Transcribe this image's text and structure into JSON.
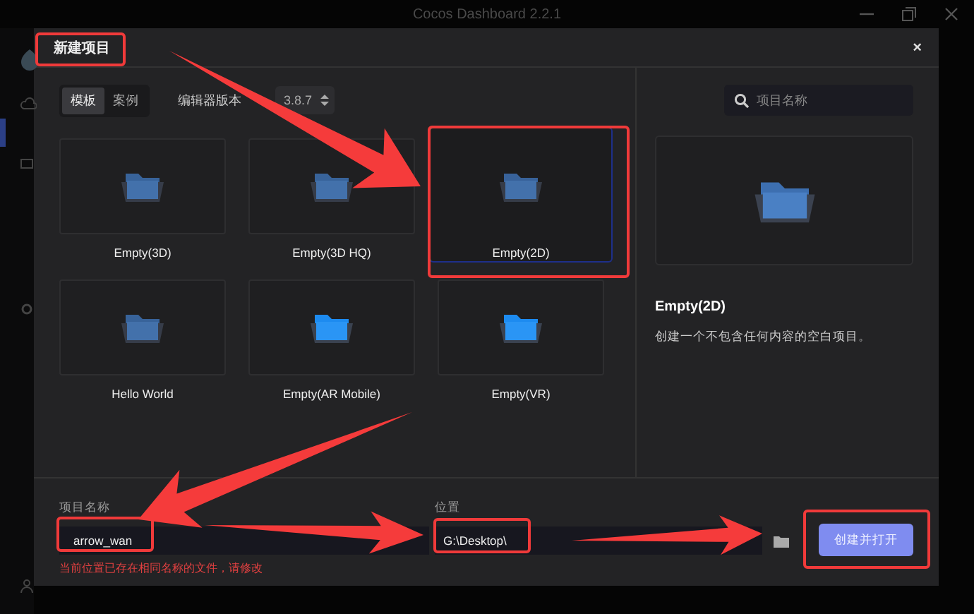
{
  "app_window": {
    "title": "Cocos Dashboard 2.2.1"
  },
  "dialog": {
    "title": "新建项目",
    "close": "×",
    "tabs": [
      {
        "label": "模板",
        "selected": true
      },
      {
        "label": "案例",
        "selected": false
      }
    ],
    "editor_version": {
      "label": "编辑器版本",
      "value": "3.8.7"
    },
    "search": {
      "placeholder": "项目名称"
    },
    "templates": [
      {
        "name": "Empty(3D)",
        "selected": false,
        "bright": false
      },
      {
        "name": "Empty(3D HQ)",
        "selected": false,
        "bright": false
      },
      {
        "name": "Empty(2D)",
        "selected": true,
        "bright": false
      },
      {
        "name": "Hello World",
        "selected": false,
        "bright": false
      },
      {
        "name": "Empty(AR Mobile)",
        "selected": false,
        "bright": true
      },
      {
        "name": "Empty(VR)",
        "selected": false,
        "bright": true
      }
    ],
    "preview": {
      "title": "Empty(2D)",
      "description": "创建一个不包含任何内容的空白项目。"
    },
    "project_name": {
      "label": "项目名称",
      "value": "arrow_wan",
      "error": "当前位置已存在相同名称的文件，请修改"
    },
    "location": {
      "label": "位置",
      "value": "G:\\Desktop\\"
    },
    "create_button": {
      "label": "创建并打开",
      "disabled": true
    }
  }
}
